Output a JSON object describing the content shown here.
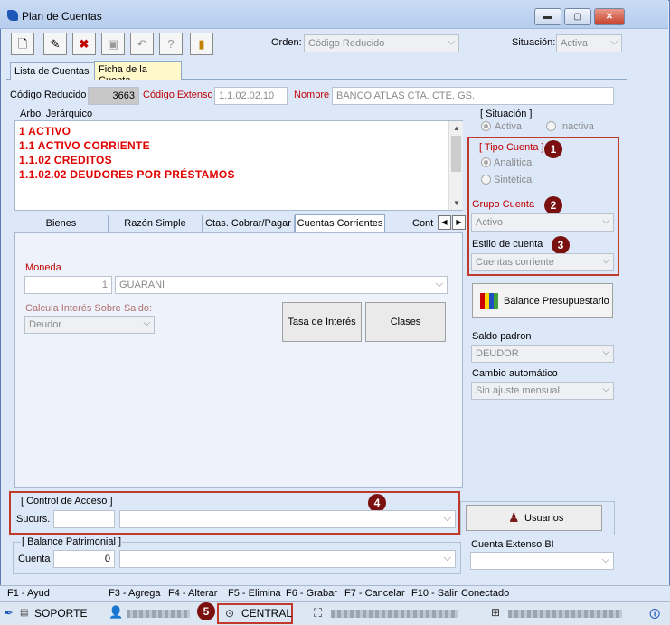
{
  "window": {
    "title": "Plan de Cuentas",
    "minimize": "▬",
    "restore": "▢",
    "close": "✕"
  },
  "toolbar": {
    "orden_label": "Orden:",
    "orden_value": "Código Reducido",
    "situacion_label": "Situación:",
    "situacion_value": "Activa"
  },
  "tabs": {
    "lista": "Lista de Cuentas",
    "ficha": "Ficha de la Cuenta"
  },
  "header": {
    "codigo_reducido_label": "Código Reducido",
    "codigo_reducido_value": "3663",
    "codigo_extenso_label": "Código Extenso",
    "codigo_extenso_value": "1.1.02.02.10",
    "nombre_label": "Nombre",
    "nombre_value": "BANCO ATLAS CTA. CTE. GS."
  },
  "tree": {
    "label": "Arbol Jerárquico",
    "items": [
      "1  ACTIVO",
      "1.1  ACTIVO CORRIENTE",
      "1.1.02  CREDITOS",
      "1.1.02.02  DEUDORES POR PRÉSTAMOS"
    ]
  },
  "subtabs": [
    "Bienes",
    "Razón Simple",
    "Ctas. Cobrar/Pagar",
    "Cuentas Corrientes",
    "Cont"
  ],
  "moneda": {
    "label": "Moneda",
    "code": "1",
    "name": "GUARANI"
  },
  "interes": {
    "label": "Calcula Interés Sobre Saldo:",
    "value": "Deudor"
  },
  "buttons": {
    "tasa": "Tasa de Interés",
    "clases": "Clases",
    "balance": "Balance Presupuestario",
    "usuarios": "Usuarios"
  },
  "situacion": {
    "title": "[ Situación ]",
    "activa": "Activa",
    "inactiva": "Inactiva"
  },
  "tipo_cuenta": {
    "title": "[ Tipo Cuenta ]",
    "analitica": "Analítica",
    "sintetica": "Sintética"
  },
  "grupo_cuenta": {
    "label": "Grupo Cuenta",
    "value": "Activo"
  },
  "estilo_cuenta": {
    "label": "Estilo de cuenta",
    "value": "Cuentas corriente"
  },
  "saldo_padron": {
    "label": "Saldo padron",
    "value": "DEUDOR"
  },
  "cambio_automatico": {
    "label": "Cambio automático",
    "value": "Sin ajuste mensual"
  },
  "control_acceso": {
    "title": "[ Control de Acceso ]",
    "sucurs_label": "Sucurs."
  },
  "balance_patrimonial": {
    "title": "[ Balance Patrimonial ]",
    "cuenta_label": "Cuenta",
    "cuenta_value": "0"
  },
  "cuenta_extenso_bi": {
    "label": "Cuenta Extenso BI"
  },
  "badges": [
    "1",
    "2",
    "3",
    "4",
    "5"
  ],
  "statusbar": [
    "F1 - Ayud",
    "F3 - Agrega",
    "F4 - Alterar",
    "F5 - Elimina",
    "F6 - Grabar",
    "F7 - Cancelar",
    "F10 - Salir",
    "Conectado"
  ],
  "taskbar": {
    "soporte": "SOPORTE",
    "central": "CENTRAL"
  },
  "colors": {
    "accent_red": "#c00000",
    "highlight": "#c0392b",
    "badge": "#7b1010"
  }
}
